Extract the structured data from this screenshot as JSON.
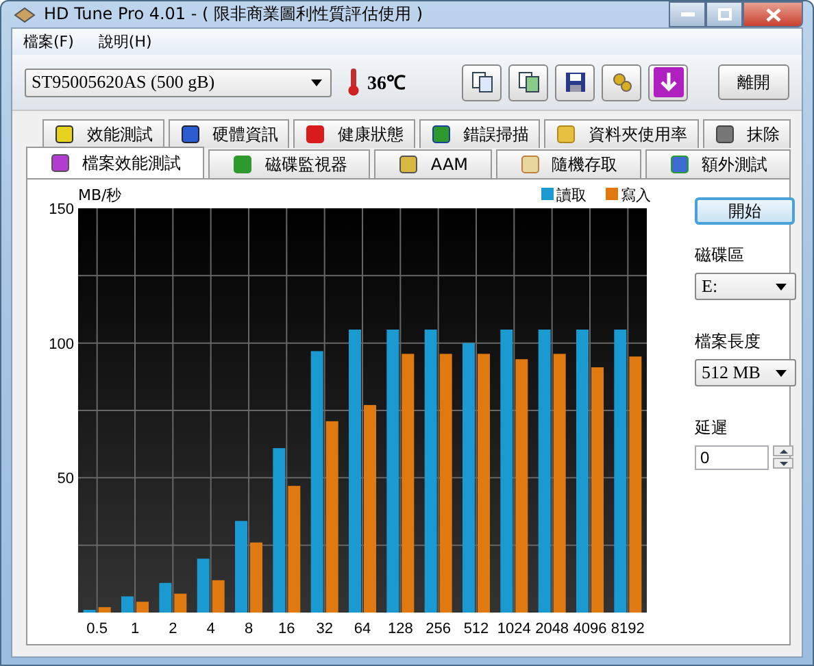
{
  "window": {
    "title": "HD Tune Pro 4.01 - ( 限非商業圖利性質評估使用 )"
  },
  "menu": [
    {
      "label": "檔案(F)"
    },
    {
      "label": "說明(H)"
    }
  ],
  "toolbar": {
    "drive": "ST95005620AS (500 gB)",
    "temperature": "36℃",
    "exit_button": "離開"
  },
  "tab_rows": [
    [
      {
        "label": "效能測試",
        "selected": false
      },
      {
        "label": "硬體資訊",
        "selected": false
      },
      {
        "label": "健康狀態",
        "selected": false
      },
      {
        "label": "錯誤掃描",
        "selected": false
      },
      {
        "label": "資料夾使用率",
        "selected": false
      },
      {
        "label": "抹除",
        "selected": false
      }
    ],
    [
      {
        "label": "檔案效能測試",
        "selected": true
      },
      {
        "label": "磁碟監視器",
        "selected": false
      },
      {
        "label": "AAM",
        "selected": false
      },
      {
        "label": "隨機存取",
        "selected": false
      },
      {
        "label": "額外測試",
        "selected": false
      }
    ]
  ],
  "side_panel": {
    "start_button": "開始",
    "drive_label": "磁碟區",
    "drive_value": "E:",
    "file_length_label": "檔案長度",
    "file_length_value": "512 MB",
    "delay_label": "延遲",
    "delay_value": "0"
  },
  "chart_data": {
    "type": "bar",
    "ylabel": "MB/秒",
    "grid": true,
    "legend": true,
    "categories": [
      "0.5",
      "1",
      "2",
      "4",
      "8",
      "16",
      "32",
      "64",
      "128",
      "256",
      "512",
      "1024",
      "2048",
      "4096",
      "8192"
    ],
    "ylim": [
      0,
      150
    ],
    "yticks": [
      50,
      100,
      150
    ],
    "series": [
      {
        "name": "讀取",
        "color": "#1a9ad0",
        "values": [
          1,
          6,
          11,
          20,
          34,
          61,
          97,
          105,
          105,
          105,
          100,
          105,
          105,
          105,
          105
        ]
      },
      {
        "name": "寫入",
        "color": "#e07a10",
        "values": [
          2,
          4,
          7,
          12,
          26,
          47,
          71,
          77,
          96,
          96,
          96,
          94,
          96,
          91,
          95
        ]
      }
    ]
  }
}
